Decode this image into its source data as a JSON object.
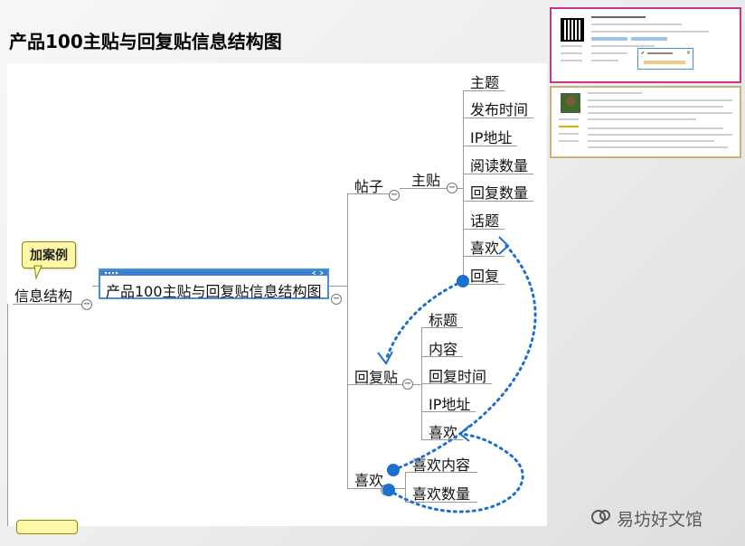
{
  "slide": {
    "title": "产品100主贴与回复贴信息结构图"
  },
  "tags": {
    "example": "加案例"
  },
  "root": {
    "label": "信息结构"
  },
  "central": {
    "label": "产品100主贴与回复贴信息结构图"
  },
  "branches": {
    "post": {
      "label": "帖子",
      "main_post": {
        "label": "主贴",
        "items": [
          "主题",
          "发布时间",
          "IP地址",
          "阅读数量",
          "回复数量",
          "话题",
          "喜欢",
          "回复"
        ]
      }
    },
    "reply": {
      "label": "回复贴",
      "items": [
        "标题",
        "内容",
        "回复时间",
        "IP地址",
        "喜欢"
      ]
    },
    "like": {
      "label": "喜欢",
      "items": [
        "喜欢内容",
        "喜欢数量"
      ]
    }
  },
  "collapse_symbol": "−",
  "colors": {
    "link": "#1a6fd0",
    "central_border": "#4a90d9",
    "thumb1_border": "#c0398a",
    "thumb2_border": "#c9b27a",
    "tag_bg": "#fff7a8"
  },
  "watermark": {
    "text": "易坊好文馆"
  }
}
